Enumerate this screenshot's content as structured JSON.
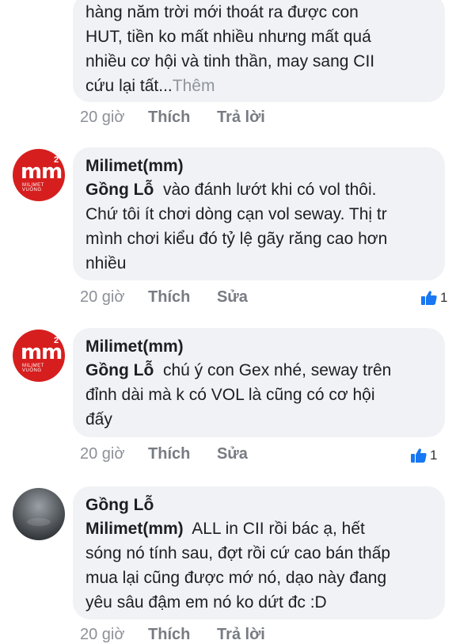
{
  "comments": [
    {
      "author": "",
      "lines": [
        "hàng năm trời mới thoát ra được con",
        "HUT, tiền ko mất nhiều nhưng mất quá",
        "nhiều cơ hội và tinh thần, may sang CII",
        "cứu lại tất..."
      ],
      "more_label": "Thêm",
      "time": "20 giờ",
      "like_label": "Thích",
      "action2_label": "Trả lời"
    },
    {
      "author": "Milimet(mm)",
      "avatar_text": "mm",
      "avatar_sup": "2",
      "avatar_tag": "MILIMET VUÔNG",
      "mention": "Gồng Lỗ",
      "text_first": "vào đánh lướt khi có vol thôi.",
      "lines": [
        "Chứ tôi ít chơi dòng cạn vol seway. Thị tr",
        "mình chơi kiểu đó tỷ lệ gãy răng cao hơn",
        "nhiều"
      ],
      "time": "20 giờ",
      "like_label": "Thích",
      "action2_label": "Sửa",
      "like_count": "1"
    },
    {
      "author": "Milimet(mm)",
      "avatar_text": "mm",
      "avatar_sup": "2",
      "avatar_tag": "MILIMET VUÔNG",
      "mention": "Gồng Lỗ",
      "text_first": "chú ý con Gex nhé, seway trên",
      "lines": [
        "đỉnh dài mà k có VOL là cũng có cơ hội",
        "đấy"
      ],
      "time": "20 giờ",
      "like_label": "Thích",
      "action2_label": "Sửa",
      "like_count": "1"
    },
    {
      "author": "Gồng Lỗ",
      "mention": "Milimet(mm)",
      "text_first": "ALL in CII rồi bác ạ, hết",
      "lines": [
        "sóng nó tính sau, đợt rồi cứ cao bán thấp",
        "mua lại cũng được mớ nó, dạo này đang",
        "yêu sâu đậm em nó ko dứt đc :D"
      ],
      "time": "20 giờ",
      "like_label": "Thích",
      "action2_label": "Trả lời"
    }
  ],
  "colors": {
    "bubble": "#f0f2f5",
    "like_blue": "#1877f2",
    "avatar_red": "#d71e1e"
  }
}
